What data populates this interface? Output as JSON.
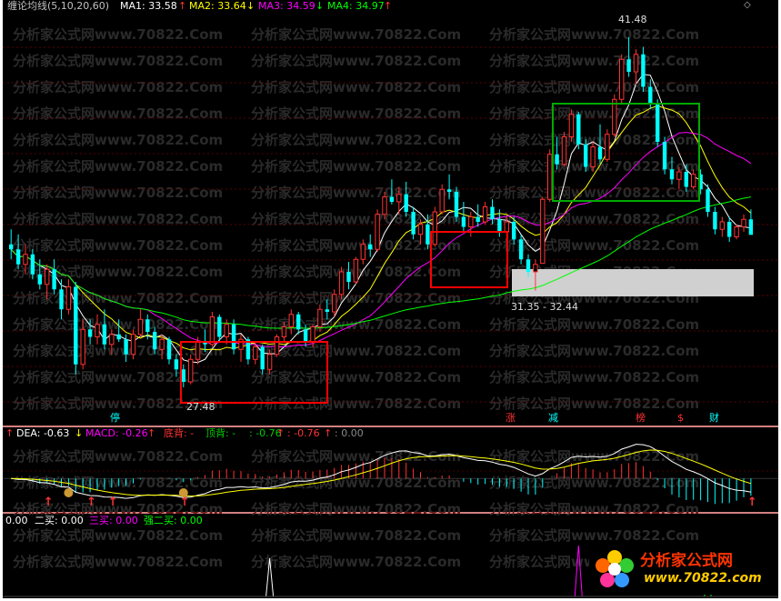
{
  "watermark": "分析家公式网www.70822.Com",
  "main_panel": {
    "indicator": "缠论均线(5,10,20,60)",
    "ma_labels": [
      {
        "text": "MA1: 33.58",
        "color": "#ffffff"
      },
      {
        "text": "MA2: 33.64",
        "color": "#ffff00"
      },
      {
        "text": "MA3: 34.59",
        "color": "#ff00ff"
      },
      {
        "text": "MA4: 34.97",
        "color": "#00ff00"
      }
    ],
    "annotations": {
      "high": "41.48",
      "low": "27.48",
      "gap": "31.35 - 32.44"
    },
    "signal_labels": [
      {
        "text": "停",
        "color": "#00ffff"
      },
      {
        "text": "涨",
        "color": "#ff3333"
      },
      {
        "text": "减",
        "color": "#00ffff"
      },
      {
        "text": "榜",
        "color": "#ff3333"
      },
      {
        "text": "$",
        "color": "#ff3333"
      },
      {
        "text": "财",
        "color": "#00ffff"
      }
    ]
  },
  "macd_panel": {
    "dea": "DEA: -0.63",
    "macd": "MACD: -0.26",
    "bottom_div": "底背: -",
    "top_div": "顶背: -",
    "v1": ": -0.76",
    "v2": ": -0.76",
    "v3": ": 0.00"
  },
  "signal_panel": {
    "buy1": "0.00",
    "buy2": "二买: 0.00",
    "buy3": "三买: 0.00",
    "strong_buy2": "强二买: 0.00"
  },
  "logo": {
    "brand": "分析家公式网",
    "url": "www.70822.com"
  },
  "colors": {
    "up_candle": "#ff3333",
    "down_candle": "#00ffff",
    "ma1": "#ffffff",
    "ma2": "#ffff00",
    "ma3": "#ff00ff",
    "ma4": "#00ff00",
    "box_red": "#ff0000",
    "box_green": "#00aa00"
  },
  "chart_data": {
    "type": "candlestick",
    "price_range": [
      26.5,
      42.5
    ],
    "candles": [
      [
        33.2,
        33.8,
        32.6,
        33.0
      ],
      [
        33.0,
        33.6,
        32.2,
        32.4
      ],
      [
        32.4,
        33.2,
        32.0,
        32.8
      ],
      [
        32.8,
        33.0,
        31.8,
        32.0
      ],
      [
        32.0,
        32.6,
        31.4,
        31.6
      ],
      [
        31.6,
        32.4,
        31.0,
        32.2
      ],
      [
        32.2,
        32.6,
        31.2,
        31.4
      ],
      [
        31.4,
        31.8,
        30.2,
        30.6
      ],
      [
        30.6,
        31.8,
        30.4,
        31.5
      ],
      [
        31.5,
        31.7,
        28.0,
        28.4
      ],
      [
        28.4,
        30.2,
        28.2,
        29.8
      ],
      [
        29.8,
        30.2,
        29.2,
        29.5
      ],
      [
        29.5,
        30.4,
        29.2,
        30.0
      ],
      [
        30.0,
        30.6,
        29.0,
        29.2
      ],
      [
        29.2,
        29.8,
        28.8,
        29.6
      ],
      [
        29.6,
        30.2,
        29.3,
        29.4
      ],
      [
        29.4,
        29.6,
        28.5,
        28.8
      ],
      [
        28.8,
        29.8,
        28.6,
        29.6
      ],
      [
        29.6,
        30.6,
        29.5,
        30.2
      ],
      [
        30.2,
        30.4,
        29.4,
        29.7
      ],
      [
        29.7,
        29.9,
        28.8,
        29.0
      ],
      [
        29.0,
        29.6,
        28.6,
        29.4
      ],
      [
        29.4,
        29.5,
        28.4,
        28.6
      ],
      [
        28.6,
        28.8,
        27.9,
        28.2
      ],
      [
        28.2,
        28.4,
        27.48,
        27.7
      ],
      [
        27.7,
        28.8,
        27.6,
        28.6
      ],
      [
        28.6,
        29.5,
        28.4,
        29.3
      ],
      [
        29.3,
        29.8,
        28.9,
        29.2
      ],
      [
        29.2,
        30.5,
        29.1,
        30.3
      ],
      [
        30.3,
        30.4,
        29.3,
        29.5
      ],
      [
        29.5,
        30.2,
        29.2,
        30.0
      ],
      [
        30.0,
        30.2,
        28.8,
        29.0
      ],
      [
        29.0,
        29.6,
        28.5,
        29.4
      ],
      [
        29.4,
        29.5,
        28.4,
        28.6
      ],
      [
        28.6,
        29.3,
        28.4,
        29.1
      ],
      [
        29.1,
        29.2,
        28.0,
        28.2
      ],
      [
        28.2,
        29.0,
        28.0,
        28.8
      ],
      [
        28.8,
        29.6,
        28.7,
        29.5
      ],
      [
        29.5,
        30.1,
        29.3,
        29.9
      ],
      [
        29.9,
        30.6,
        29.6,
        30.4
      ],
      [
        30.4,
        30.5,
        29.6,
        29.8
      ],
      [
        29.8,
        30.0,
        29.1,
        29.3
      ],
      [
        29.3,
        30.0,
        29.1,
        29.9
      ],
      [
        29.9,
        30.8,
        29.7,
        30.6
      ],
      [
        30.6,
        31.0,
        30.2,
        30.5
      ],
      [
        30.5,
        31.4,
        30.3,
        31.2
      ],
      [
        31.2,
        32.3,
        31.0,
        32.1
      ],
      [
        32.1,
        32.5,
        31.4,
        31.7
      ],
      [
        31.7,
        32.7,
        31.6,
        32.6
      ],
      [
        32.6,
        33.4,
        32.4,
        33.2
      ],
      [
        33.2,
        33.6,
        32.7,
        33.0
      ],
      [
        33.0,
        34.6,
        32.9,
        34.4
      ],
      [
        34.4,
        35.3,
        34.2,
        35.1
      ],
      [
        35.1,
        35.8,
        34.8,
        34.9
      ],
      [
        34.9,
        35.5,
        34.4,
        35.2
      ],
      [
        35.2,
        35.7,
        34.3,
        34.5
      ],
      [
        34.5,
        34.7,
        33.4,
        33.6
      ],
      [
        33.6,
        34.2,
        33.2,
        34.0
      ],
      [
        34.0,
        34.4,
        33.0,
        33.2
      ],
      [
        33.2,
        34.7,
        33.1,
        34.5
      ],
      [
        34.5,
        35.6,
        34.4,
        35.4
      ],
      [
        35.4,
        36.0,
        35.0,
        35.3
      ],
      [
        35.3,
        35.5,
        34.1,
        34.3
      ],
      [
        34.3,
        34.9,
        33.7,
        33.9
      ],
      [
        33.9,
        34.5,
        33.5,
        34.3
      ],
      [
        34.3,
        34.8,
        33.9,
        34.1
      ],
      [
        34.1,
        34.9,
        34.0,
        34.7
      ],
      [
        34.7,
        35.0,
        34.0,
        34.2
      ],
      [
        34.2,
        34.6,
        33.5,
        33.7
      ],
      [
        33.7,
        34.3,
        33.3,
        34.1
      ],
      [
        34.1,
        34.3,
        33.2,
        33.4
      ],
      [
        33.4,
        33.6,
        32.4,
        32.6
      ],
      [
        32.6,
        32.8,
        31.9,
        32.1
      ],
      [
        32.1,
        32.6,
        31.35,
        32.4
      ],
      [
        32.44,
        35.1,
        32.44,
        35.0
      ],
      [
        35.0,
        37.0,
        34.9,
        36.8
      ],
      [
        36.8,
        37.5,
        36.2,
        36.4
      ],
      [
        36.4,
        37.7,
        36.3,
        37.5
      ],
      [
        37.5,
        38.6,
        37.3,
        38.4
      ],
      [
        38.4,
        38.5,
        37.0,
        37.2
      ],
      [
        37.2,
        37.4,
        36.1,
        36.3
      ],
      [
        36.3,
        37.3,
        36.1,
        37.1
      ],
      [
        37.1,
        38.0,
        36.4,
        36.6
      ],
      [
        36.6,
        37.8,
        36.5,
        37.6
      ],
      [
        37.6,
        39.2,
        37.5,
        39.0
      ],
      [
        39.0,
        40.8,
        38.8,
        40.6
      ],
      [
        40.6,
        41.48,
        39.9,
        40.1
      ],
      [
        40.1,
        41.0,
        39.6,
        40.8
      ],
      [
        40.8,
        41.1,
        39.3,
        39.5
      ],
      [
        39.5,
        39.8,
        38.6,
        38.8
      ],
      [
        38.8,
        39.0,
        37.1,
        37.3
      ],
      [
        37.3,
        37.5,
        36.0,
        36.2
      ],
      [
        36.2,
        36.7,
        35.6,
        35.8
      ],
      [
        35.8,
        36.3,
        35.4,
        36.1
      ],
      [
        36.1,
        36.4,
        35.3,
        35.5
      ],
      [
        35.5,
        36.2,
        35.4,
        36.0
      ],
      [
        36.0,
        36.2,
        35.2,
        35.4
      ],
      [
        35.4,
        35.6,
        34.3,
        34.5
      ],
      [
        34.5,
        34.7,
        33.6,
        33.8
      ],
      [
        33.8,
        34.3,
        33.5,
        34.1
      ],
      [
        34.1,
        34.3,
        33.3,
        33.5
      ],
      [
        33.5,
        34.0,
        33.4,
        33.9
      ],
      [
        33.9,
        34.4,
        33.7,
        34.2
      ],
      [
        34.2,
        34.6,
        33.6,
        33.58
      ]
    ],
    "ma_periods": [
      5,
      10,
      20,
      60
    ],
    "macd_range": [
      -1.6,
      1.8
    ],
    "signals_range": [
      0,
      1
    ]
  }
}
